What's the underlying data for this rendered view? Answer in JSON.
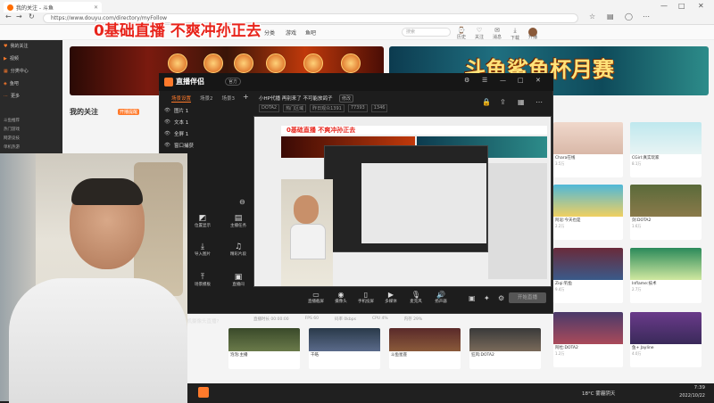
{
  "browser": {
    "tab_title": "我的关注 - 斗鱼",
    "url": "https://www.douyu.com/directory/myFollow",
    "controls": {
      "minimize": "—",
      "maximize": "□",
      "close": "✕"
    }
  },
  "overlay_title": "0基础直播 不爽冲孙正去",
  "site_header": {
    "nav": [
      "分类",
      "游戏",
      "鱼吧"
    ],
    "search_placeholder": "搜索",
    "icons": [
      {
        "icon": "history-icon",
        "label": "历史"
      },
      {
        "icon": "follow-icon",
        "label": "关注"
      },
      {
        "icon": "message-icon",
        "label": "消息"
      },
      {
        "icon": "download-icon",
        "label": "下载"
      },
      {
        "icon": "live-icon",
        "label": "开播"
      }
    ]
  },
  "sidebar": {
    "items": [
      {
        "icon": "follow-icon",
        "label": "我的关注"
      },
      {
        "icon": "video-icon",
        "label": "视频"
      },
      {
        "icon": "category-icon",
        "label": "分类中心"
      },
      {
        "icon": "fishbar-icon",
        "label": "鱼吧"
      },
      {
        "icon": "more-icon",
        "label": "更多"
      }
    ],
    "small_items": [
      "斗鱼推荐",
      "热门游戏",
      "网游竞技",
      "单机热游",
      "手游休闲",
      "娱乐天地",
      "科技文化"
    ]
  },
  "banner_right_title": "斗鱼鲨鱼杯月赛",
  "my_follow": {
    "title": "我的关注",
    "badge": "开播提醒"
  },
  "app": {
    "name": "直播伴侣",
    "version": "官方",
    "scene_tabs": [
      "场景设置",
      "场景2",
      "场景3"
    ],
    "layers": [
      "图片 1",
      "文本 1",
      "全屏 1",
      "窗口捕获"
    ],
    "room_title": "小HP代播 再别来了 不可能放鸽子",
    "room_edit": "修改",
    "room_tags": [
      "DOTA2",
      "热门区域",
      "昨日观众1391",
      "77393",
      "1346"
    ],
    "left_tools": [
      {
        "icon": "image-icon",
        "label": "位置显示"
      },
      {
        "icon": "text-icon",
        "label": "主播任务"
      },
      {
        "icon": "import-icon",
        "label": "导入图片"
      },
      {
        "icon": "music-icon",
        "label": "精彩片段"
      },
      {
        "icon": "template-icon",
        "label": "场景模板"
      },
      {
        "icon": "calendar-icon",
        "label": "直播间"
      }
    ],
    "bottom_tools": [
      {
        "icon": "screen-icon",
        "label": "直播截屏"
      },
      {
        "icon": "camera-icon",
        "label": "摄像头"
      },
      {
        "icon": "phone-icon",
        "label": "手机投屏"
      },
      {
        "icon": "media-icon",
        "label": "多媒体"
      },
      {
        "icon": "mic-icon",
        "label": "麦克风"
      },
      {
        "icon": "speaker-icon",
        "label": "扬声器"
      }
    ],
    "go_live": "开始直播",
    "status": [
      "直播时长 00:00:00",
      "FPS 60",
      "码率 0kbps",
      "CPU 4%",
      "内存 29%"
    ],
    "stream_hint": "手机摄像头直播?"
  },
  "cards": [
    {
      "title": "Chara在线",
      "views": "3.5万"
    },
    {
      "title": "CGirl:真实玩家",
      "views": "8.1万"
    },
    {
      "title": "阿逗:今天也是",
      "views": "2.2万"
    },
    {
      "title": "剑:DOTA2",
      "views": "1.6万"
    },
    {
      "title": "Ziqi:钓鱼",
      "views": "9.4万"
    },
    {
      "title": "Inflame:技术",
      "views": "2.7万"
    },
    {
      "title": "阿杜:DOTA2",
      "views": "1.2万"
    },
    {
      "title": "泡泡:主播",
      "views": "6.4万"
    },
    {
      "title": "千皓",
      "views": "3.1万"
    },
    {
      "title": "斗鱼星座",
      "views": "1.8万"
    },
    {
      "title": "狂风:DOTA2",
      "views": "2.4万"
    },
    {
      "title": "鱼+ Jayline",
      "views": "4.0万"
    }
  ],
  "taskbar": {
    "weather": "18°C 雾霾阴天",
    "time": "7:39",
    "date": "2022/10/22"
  },
  "colors": {
    "accent": "#ff7a2b",
    "overlay_text": "#e8241b"
  }
}
